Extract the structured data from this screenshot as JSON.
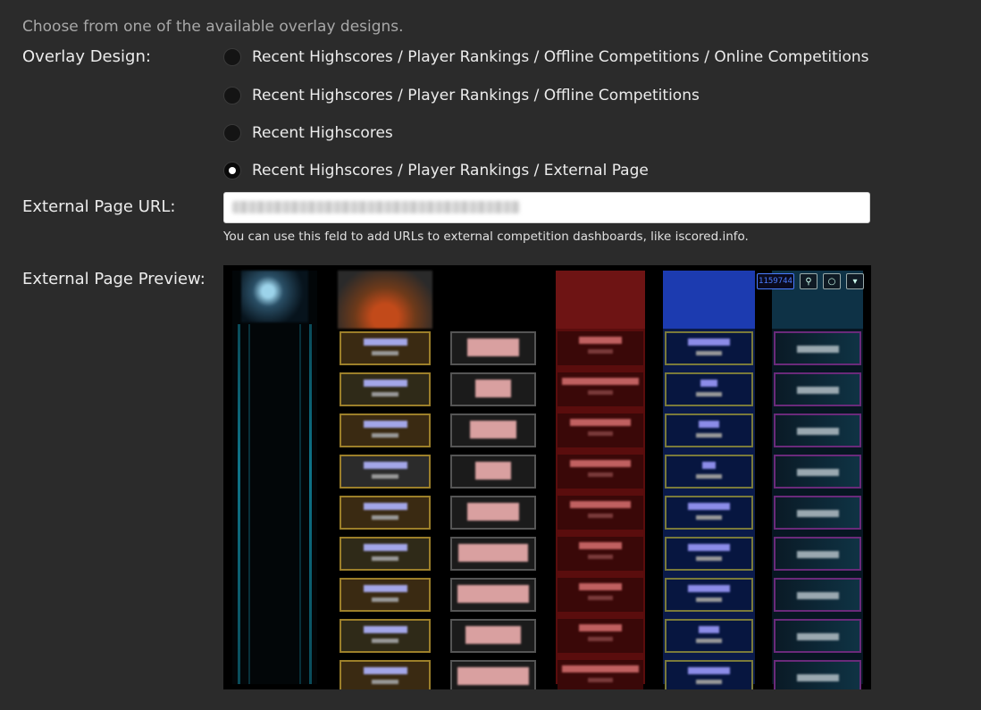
{
  "intro": "Choose from one of the available overlay designs.",
  "overlay_design": {
    "label": "Overlay Design:",
    "options": [
      "Recent Highscores / Player Rankings / Offline Competitions / Online Competitions",
      "Recent Highscores / Player Rankings / Offline Competitions",
      "Recent Highscores",
      "Recent Highscores / Player Rankings / External Page"
    ],
    "selected_index": 3
  },
  "external_url": {
    "label": "External Page URL:",
    "value": "",
    "help": "You can use this feld to add URLs to external competition dashboards, like iscored.info."
  },
  "preview": {
    "label": "External Page Preview:",
    "digital_readout": "1159744"
  }
}
